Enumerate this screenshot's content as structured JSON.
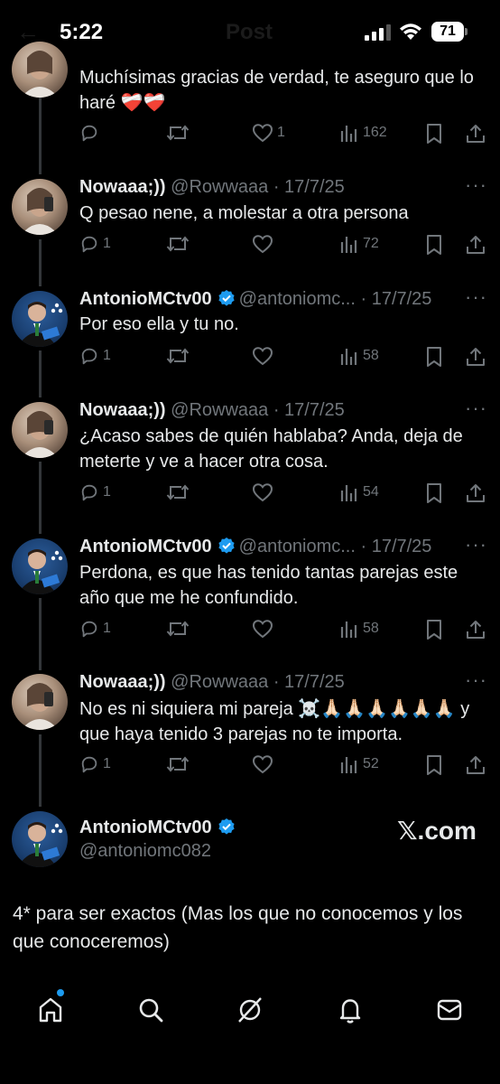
{
  "status_bar": {
    "time": "5:22",
    "battery": "71"
  },
  "header": {
    "title": "Post"
  },
  "colors": {
    "background": "#000000",
    "text": "#e7e9ea",
    "muted": "#71767b",
    "accent": "#1d9bf0"
  },
  "tweets": [
    {
      "text": "Muchísimas gracias de verdad, te aseguro que lo haré ❤️‍🩹❤️‍🩹",
      "replies": "",
      "likes": "1",
      "views": "162"
    },
    {
      "name": "Nowaaa;))",
      "handle": "@Rowwaaa",
      "date": "· 17/7/25",
      "text": "Q pesao nene, a molestar a otra persona",
      "replies": "1",
      "likes": "",
      "views": "72"
    },
    {
      "name": "AntonioMCtv00",
      "handle": "@antoniomc...",
      "date": "· 17/7/25",
      "text": "Por eso ella y tu no.",
      "replies": "1",
      "likes": "",
      "views": "58"
    },
    {
      "name": "Nowaaa;))",
      "handle": "@Rowwaaa",
      "date": "· 17/7/25",
      "text": "¿Acaso sabes de quién hablaba? Anda, deja de meterte y ve a hacer otra cosa.",
      "replies": "1",
      "likes": "",
      "views": "54"
    },
    {
      "name": "AntonioMCtv00",
      "handle": "@antoniomc...",
      "date": "· 17/7/25",
      "text": "Perdona, es que has tenido tantas parejas este año que me he confundido.",
      "replies": "1",
      "likes": "",
      "views": "58"
    },
    {
      "name": "Nowaaa;))",
      "handle": "@Rowwaaa",
      "date": "· 17/7/25",
      "text": "No es ni siquiera mi pareja ☠️🙏🏻🙏🏻🙏🏻🙏🏻🙏🏻🙏🏻 y que haya tenido 3 parejas no te importa.",
      "replies": "1",
      "likes": "",
      "views": "52"
    }
  ],
  "main_tweet": {
    "name": "AntonioMCtv00",
    "handle": "@antoniomc082",
    "watermark": "𝕏.com",
    "text": "4* para ser exactos (Mas los que no conocemos y los que conoceremos)"
  },
  "tab_bar": {
    "items": [
      "home-icon",
      "search-icon",
      "grok-icon",
      "notifications-icon",
      "messages-icon"
    ]
  }
}
